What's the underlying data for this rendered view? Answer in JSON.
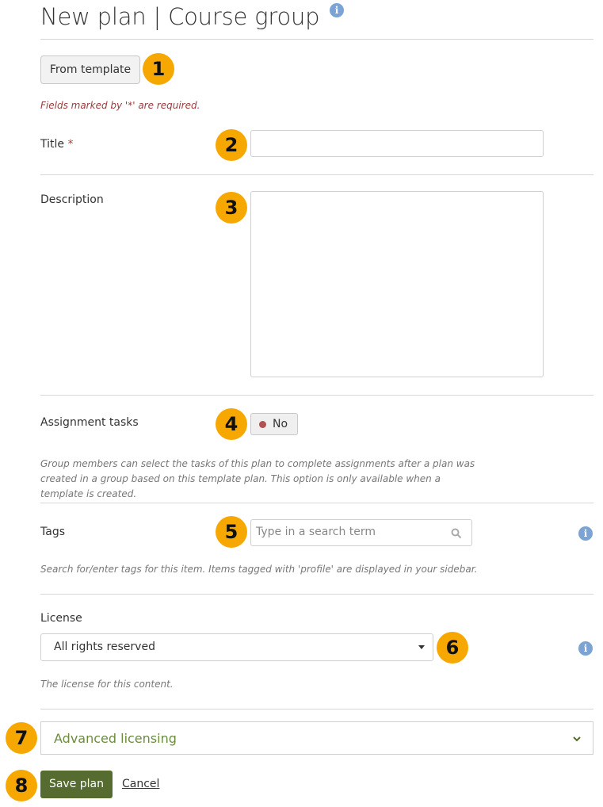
{
  "header": {
    "title": "New plan | Course group",
    "info_icon": "info-icon"
  },
  "from_template_label": "From template",
  "required_note": "Fields marked by '*' are required.",
  "fields": {
    "title": {
      "label": "Title",
      "required_mark": "*",
      "value": ""
    },
    "description": {
      "label": "Description",
      "value": ""
    },
    "assignment_tasks": {
      "label": "Assignment tasks",
      "toggle_value": "No",
      "help": "Group members can select the tasks of this plan to complete assignments after a plan was created in a group based on this template plan. This option is only available when a template is created."
    },
    "tags": {
      "label": "Tags",
      "placeholder": "Type in a search term",
      "help": "Search for/enter tags for this item. Items tagged with 'profile' are displayed in your sidebar."
    },
    "license": {
      "label": "License",
      "selected": "All rights reserved",
      "help": "The license for this content."
    }
  },
  "advanced_licensing_label": "Advanced licensing",
  "actions": {
    "save_label": "Save plan",
    "cancel_label": "Cancel"
  },
  "badges": [
    "1",
    "2",
    "3",
    "4",
    "5",
    "6",
    "7",
    "8"
  ],
  "colors": {
    "badge": "#f7a800",
    "save": "#556b2f",
    "info": "#7ba3d4",
    "required": "#9a3a3a"
  }
}
